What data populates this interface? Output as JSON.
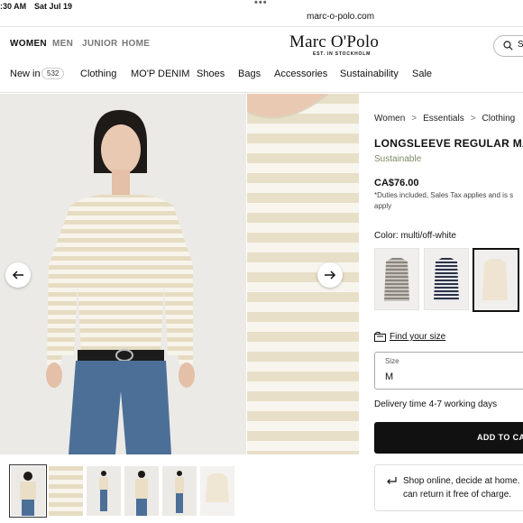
{
  "status_bar": {
    "time": ":30 AM",
    "date": "Sat Jul 19"
  },
  "browser": {
    "url": "marc-o-polo.com"
  },
  "top_nav": {
    "women": "WOMEN",
    "men": "MEN",
    "junior": "JUNIOR",
    "home": "HOME"
  },
  "brand": {
    "logo": "Marc O'Polo",
    "tagline": "EST. IN STOCKHOLM"
  },
  "search": {
    "label": "S"
  },
  "categories": {
    "new_in": "New in",
    "new_in_count": "532",
    "clothing": "Clothing",
    "denim": "MO'P DENIM",
    "shoes": "Shoes",
    "bags": "Bags",
    "accessories": "Accessories",
    "sustainability": "Sustainability",
    "sale": "Sale"
  },
  "breadcrumb": {
    "women": "Women",
    "essentials": "Essentials",
    "clothing": "Clothing",
    "sep": ">"
  },
  "product": {
    "title": "LONGSLEEVE REGULAR MADE",
    "sustainable": "Sustainable",
    "price": "CA$76.00",
    "price_note_1": "*Duties included, Sales Tax applies and is s",
    "price_note_2": "apply",
    "color_label": "Color: multi/off-white"
  },
  "size": {
    "find_size": "Find your size",
    "label": "Size",
    "value": "M"
  },
  "delivery": "Delivery time 4-7 working days",
  "add_to_cart": "ADD TO CART",
  "returns": {
    "line1": "Shop online, decide at home.",
    "line2": "can return it free of charge."
  },
  "colors": {
    "stripe_beige": "#e6dcc2",
    "stripe_white": "#f7f4ec",
    "accent_green": "#7d8a63",
    "button_black": "#111111"
  }
}
